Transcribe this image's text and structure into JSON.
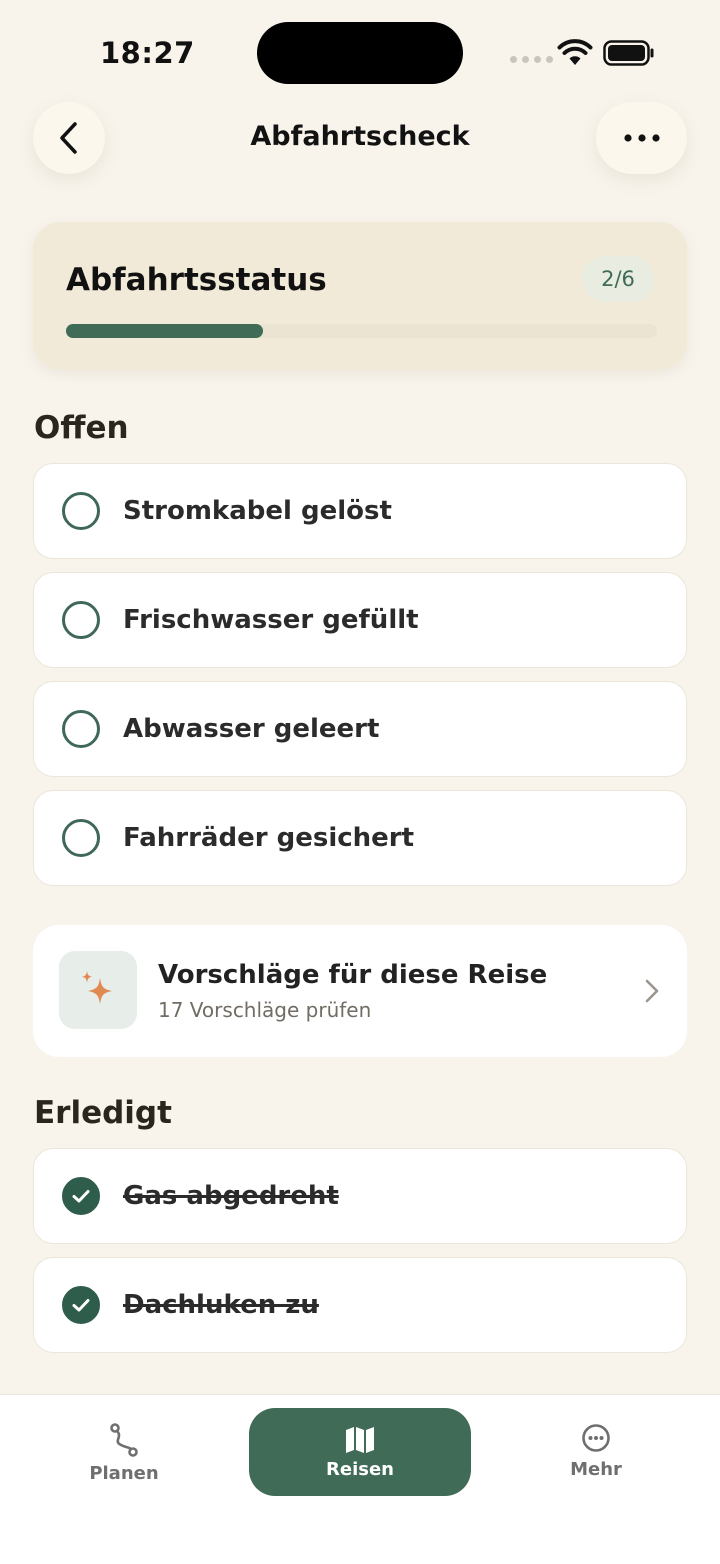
{
  "status_bar": {
    "time": "18:27"
  },
  "nav": {
    "title": "Abfahrtscheck"
  },
  "status_card": {
    "title": "Abfahrtsstatus",
    "badge": "2/6",
    "progress_fraction": 0.333
  },
  "sections": {
    "open_heading": "Offen",
    "done_heading": "Erledigt"
  },
  "open_tasks": [
    {
      "label": "Stromkabel gelöst"
    },
    {
      "label": "Frischwasser gefüllt"
    },
    {
      "label": "Abwasser geleert"
    },
    {
      "label": "Fahrräder gesichert"
    }
  ],
  "suggestions": {
    "title": "Vorschläge für diese Reise",
    "subtitle": "17 Vorschläge prüfen"
  },
  "done_tasks": [
    {
      "label": "Gas abgedreht"
    },
    {
      "label": "Dachluken zu"
    }
  ],
  "tabbar": {
    "planen": "Planen",
    "reisen": "Reisen",
    "mehr": "Mehr"
  },
  "colors": {
    "accent": "#3f6b57",
    "background": "#f8f4ec",
    "sparkle": "#e08a52"
  }
}
